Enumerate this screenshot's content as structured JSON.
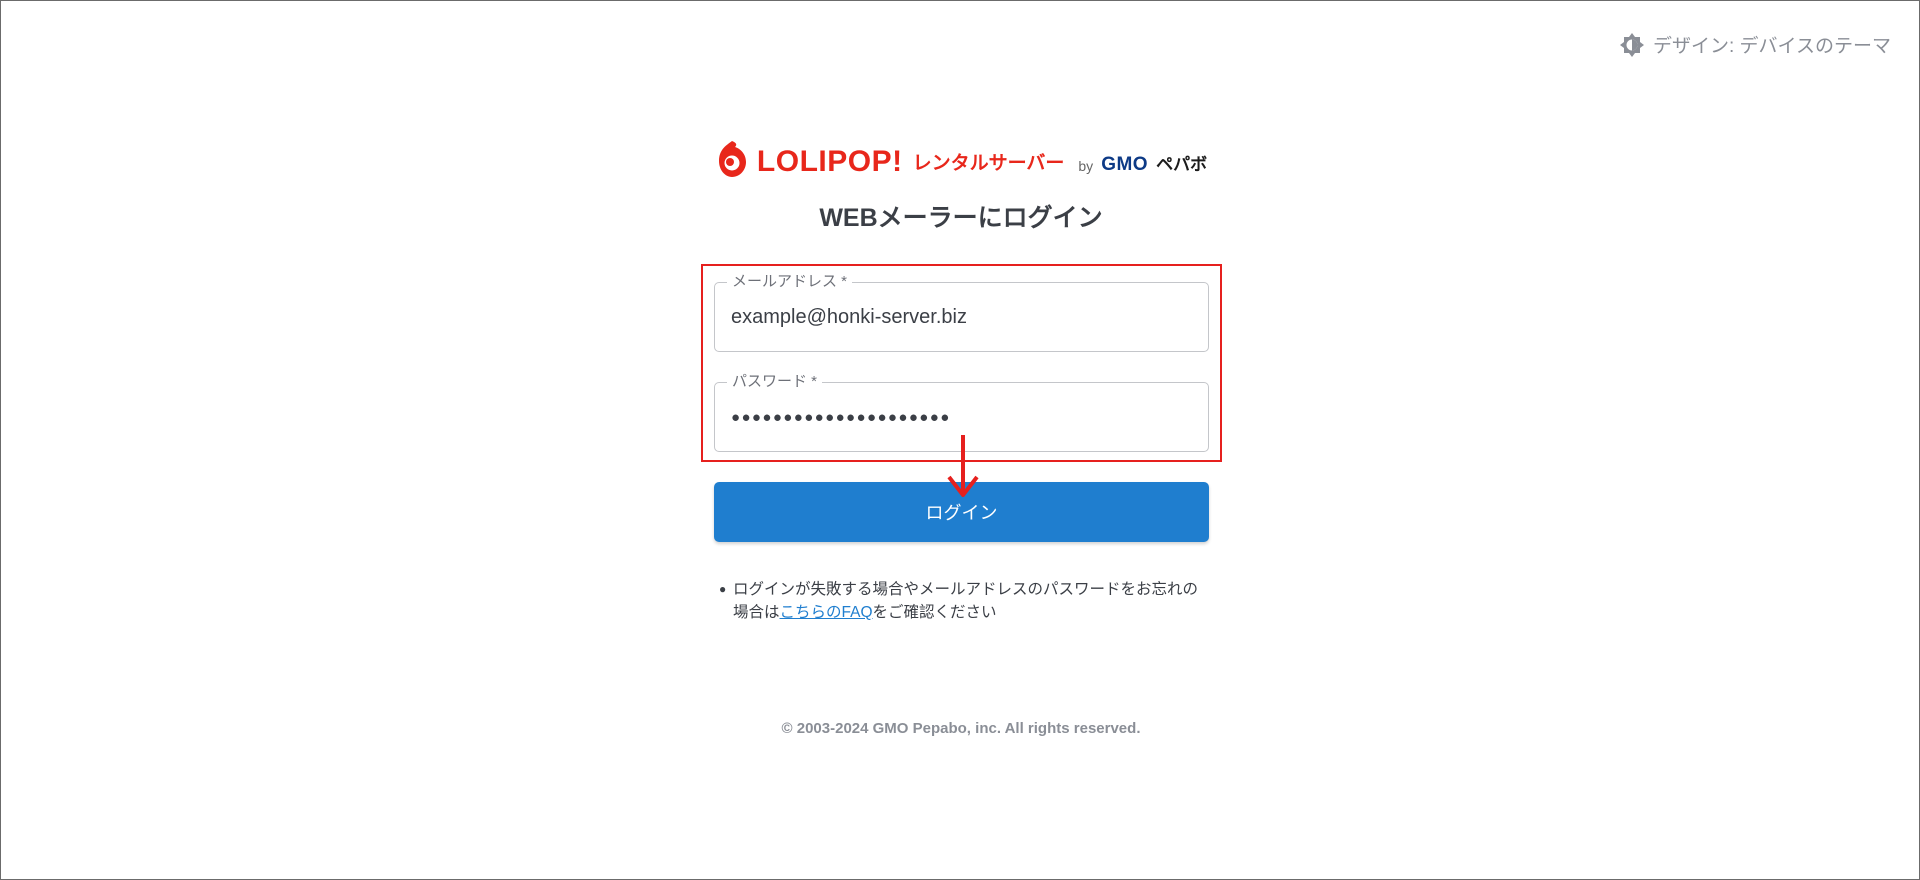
{
  "theme": {
    "label": "デザイン: デバイスのテーマ",
    "icon": "theme-icon"
  },
  "logo": {
    "brand": "LOLIPOP!",
    "sub": "レンタルサーバー",
    "by": "by",
    "company": "GMO",
    "company_sub": "ペパボ"
  },
  "page": {
    "title": "WEBメーラーにログイン"
  },
  "form": {
    "email": {
      "label": "メールアドレス *",
      "value": "example@honki-server.biz"
    },
    "password": {
      "label": "パスワード *",
      "value": "●●●●●●●●●●●●●●●●●●●●●"
    },
    "submit_label": "ログイン"
  },
  "note": {
    "text_before": "ログインが失敗する場合やメールアドレスのパスワードをお忘れの場合は",
    "link": "こちらのFAQ",
    "text_after": "をご確認ください"
  },
  "footer": {
    "copyright": "© 2003-2024 GMO Pepabo, inc. All rights reserved."
  },
  "colors": {
    "brand": "#e8271b",
    "button": "#1f7ecf",
    "highlight": "#e6201e",
    "link": "#1f7ecf"
  }
}
